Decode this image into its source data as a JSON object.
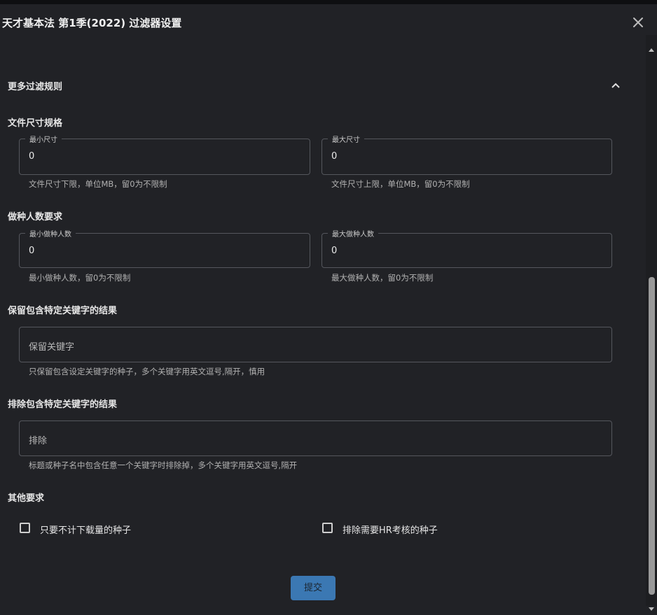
{
  "dialog": {
    "title": "天才基本法 第1季(2022) 过滤器设置"
  },
  "icons": {
    "close": "close-icon",
    "collapse": "chevron-up-icon"
  },
  "section": {
    "label": "更多过滤规则"
  },
  "file_size": {
    "title": "文件尺寸规格",
    "min": {
      "label": "最小尺寸",
      "value": "0",
      "hint": "文件尺寸下限，单位MB，留0为不限制"
    },
    "max": {
      "label": "最大尺寸",
      "value": "0",
      "hint": "文件尺寸上限，单位MB，留0为不限制"
    }
  },
  "seeders": {
    "title": "做种人数要求",
    "min": {
      "label": "最小做种人数",
      "value": "0",
      "hint": "最小做种人数，留0为不限制"
    },
    "max": {
      "label": "最大做种人数",
      "value": "0",
      "hint": "最大做种人数，留0为不限制"
    }
  },
  "include": {
    "title": "保留包含特定关键字的结果",
    "placeholder": "保留关键字",
    "hint": "只保留包含设定关键字的种子，多个关键字用英文逗号,隔开，慎用"
  },
  "exclude": {
    "title": "排除包含特定关键字的结果",
    "placeholder": "排除",
    "hint": "标题或种子名中包含任意一个关键字时排除掉，多个关键字用英文逗号,隔开"
  },
  "other": {
    "title": "其他要求",
    "free_download": {
      "label": "只要不计下载量的种子",
      "checked": false
    },
    "exclude_hr": {
      "label": "排除需要HR考核的种子",
      "checked": false
    }
  },
  "submit": {
    "label": "提交"
  },
  "colors": {
    "background": "#212226",
    "accent": "#3b78b3",
    "border": "#55575d"
  }
}
